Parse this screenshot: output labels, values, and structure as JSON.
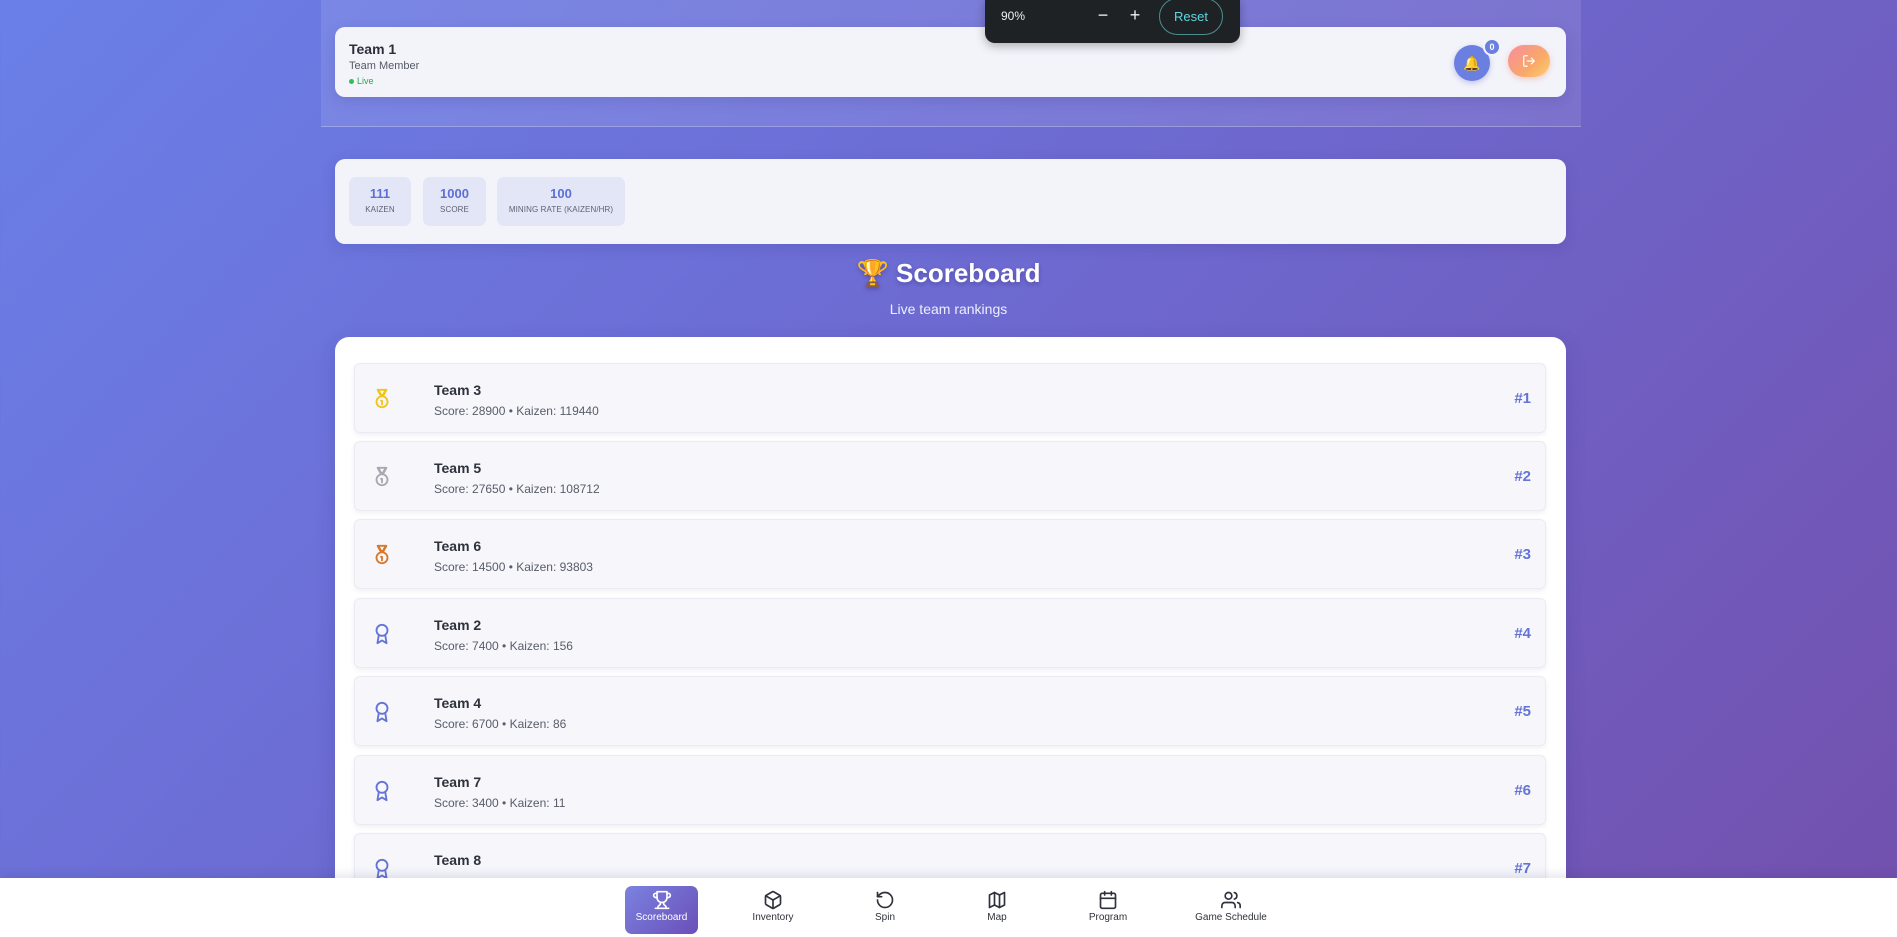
{
  "header": {
    "team_name": "Team 1",
    "role": "Team Member",
    "status": "Live",
    "notification_count": "0"
  },
  "zoom": {
    "level": "90%",
    "minus": "−",
    "plus": "+",
    "reset": "Reset"
  },
  "stats": [
    {
      "value": "111",
      "label": "Kaizen"
    },
    {
      "value": "1000",
      "label": "Score"
    },
    {
      "value": "100",
      "label": "Mining Rate (Kaizen/hr)"
    }
  ],
  "scoreboard": {
    "icon": "🏆",
    "title": "Scoreboard",
    "subtitle": "Live team rankings"
  },
  "rankings": [
    {
      "name": "Team 3",
      "meta": "Score: 28900 • Kaizen: 119440",
      "rank": "#1",
      "icon": "medal-gold-icon"
    },
    {
      "name": "Team 5",
      "meta": "Score: 27650 • Kaizen: 108712",
      "rank": "#2",
      "icon": "medal-silver-icon"
    },
    {
      "name": "Team 6",
      "meta": "Score: 14500 • Kaizen: 93803",
      "rank": "#3",
      "icon": "medal-bronze-icon"
    },
    {
      "name": "Team 2",
      "meta": "Score: 7400 • Kaizen: 156",
      "rank": "#4",
      "icon": "award-ribbon-icon"
    },
    {
      "name": "Team 4",
      "meta": "Score: 6700 • Kaizen: 86",
      "rank": "#5",
      "icon": "award-ribbon-icon"
    },
    {
      "name": "Team 7",
      "meta": "Score: 3400 • Kaizen: 11",
      "rank": "#6",
      "icon": "award-ribbon-icon"
    },
    {
      "name": "Team 8",
      "meta": "",
      "rank": "#7",
      "icon": "award-ribbon-icon"
    }
  ],
  "nav": [
    {
      "label": "Scoreboard",
      "icon": "trophy-icon",
      "active": true
    },
    {
      "label": "Inventory",
      "icon": "box-icon"
    },
    {
      "label": "Spin",
      "icon": "rotate-icon"
    },
    {
      "label": "Map",
      "icon": "map-icon"
    },
    {
      "label": "Program",
      "icon": "calendar-icon"
    },
    {
      "label": "Game Schedule",
      "icon": "users-icon"
    }
  ],
  "colors": {
    "accent": "#6474d6",
    "gold": "#f2c417",
    "silver": "#a8a8b0",
    "bronze": "#d9782a",
    "live": "#2fbf59"
  }
}
